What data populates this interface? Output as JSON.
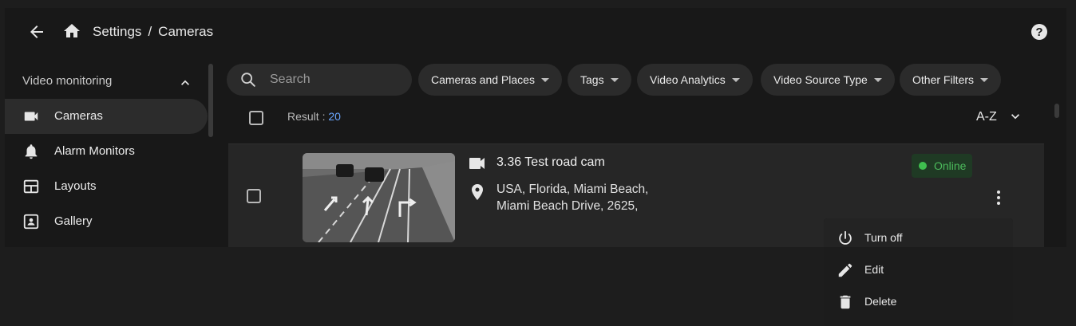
{
  "header": {
    "breadcrumb_root": "Settings",
    "breadcrumb_sep": "/",
    "breadcrumb_current": "Cameras"
  },
  "sidebar": {
    "section_title": "Video monitoring",
    "items": [
      {
        "label": "Cameras",
        "icon": "videocam-icon",
        "active": true
      },
      {
        "label": "Alarm Monitors",
        "icon": "bell-icon"
      },
      {
        "label": "Layouts",
        "icon": "layout-grid-icon"
      },
      {
        "label": "Gallery",
        "icon": "image-icon"
      }
    ]
  },
  "search": {
    "placeholder": "Search"
  },
  "filters": [
    "Cameras and Places",
    "Tags",
    "Video Analytics",
    "Video Source Type",
    "Other Filters"
  ],
  "results": {
    "label": "Result : ",
    "count": "20"
  },
  "sort": {
    "label": "A-Z"
  },
  "camera": {
    "name": "3.36 Test road cam",
    "address_line1": "USA, Florida, Miami Beach,",
    "address_line2": "Miami Beach Drive, 2625,",
    "status": "Online"
  },
  "context_menu": [
    {
      "label": "Turn off",
      "icon": "power-icon"
    },
    {
      "label": "Edit",
      "icon": "pencil-icon"
    },
    {
      "label": "Delete",
      "icon": "trash-icon"
    }
  ],
  "colors": {
    "background": "#181818",
    "surface": "#2b2b2b",
    "accent": "#6aa6ff",
    "online": "#3fbf4f"
  }
}
